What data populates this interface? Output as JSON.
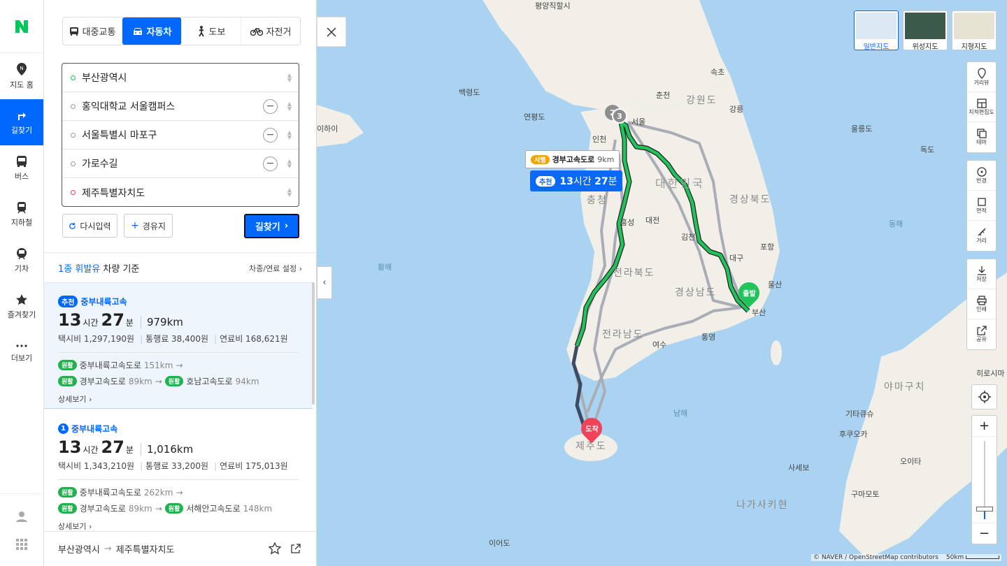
{
  "nav": {
    "items": [
      {
        "label": "지도 홈"
      },
      {
        "label": "길찾기"
      },
      {
        "label": "버스"
      },
      {
        "label": "지하철"
      },
      {
        "label": "기차"
      },
      {
        "label": "즐겨찾기"
      },
      {
        "label": "더보기"
      }
    ]
  },
  "modes": {
    "transit": "대중교통",
    "car": "자동차",
    "walk": "도보",
    "bike": "자전거"
  },
  "stops": [
    {
      "value": "부산광역시"
    },
    {
      "value": "홍익대학교 서울캠퍼스"
    },
    {
      "value": "서울특별시 마포구"
    },
    {
      "value": "가로수길"
    },
    {
      "value": "제주특별자치도"
    }
  ],
  "actions": {
    "reset": "다시입력",
    "waypoint": "경유지",
    "search": "길찾기"
  },
  "vehicle": {
    "fuel": "1종 휘발유",
    "basis": "차량 기준",
    "settings": "차종/연료 설정"
  },
  "routes": [
    {
      "tag": "추천",
      "name": "중부내륙고속",
      "hours": "13",
      "h_unit": "시간",
      "minutes": "27",
      "m_unit": "분",
      "distance": "979km",
      "taxi": "택시비 1,297,190원",
      "toll": "통행료 38,400원",
      "fuel": "연료비 168,621원",
      "road1": "중부내륙고속도로",
      "road1_km": "151km",
      "road2": "경부고속도로",
      "road2_km": "89km",
      "road3": "호남고속도로",
      "road3_km": "94km",
      "badge": "원활",
      "detail": "상세보기"
    },
    {
      "tag": "1",
      "name": "중부내륙고속",
      "hours": "13",
      "h_unit": "시간",
      "minutes": "27",
      "m_unit": "분",
      "distance": "1,016km",
      "taxi": "택시비 1,343,210원",
      "toll": "통행료 33,200원",
      "fuel": "연료비 175,013원",
      "road1": "중부내륙고속도로",
      "road1_km": "262km",
      "road2": "경부고속도로",
      "road2_km": "89km",
      "road3": "서해안고속도로",
      "road3_km": "148km",
      "badge": "원활",
      "detail": "상세보기"
    }
  ],
  "footer": {
    "from": "부산광역시",
    "to": "제주특별자치도"
  },
  "map": {
    "types": [
      {
        "label": "일반지도"
      },
      {
        "label": "위성지도"
      },
      {
        "label": "지형지도"
      }
    ],
    "tools": [
      "거리뷰",
      "지적편집도",
      "테마",
      "반경",
      "면적",
      "거리",
      "저장",
      "인쇄",
      "공유"
    ],
    "labels": {
      "pyongyang": "평양직할시",
      "sokcho": "속초",
      "chuncheon": "춘천",
      "gangwon": "강원도",
      "gangneung": "강릉",
      "baengnyeong": "백령도",
      "yeonpyeong": "연평도",
      "weihai": "이하이",
      "ulleung": "울릉도",
      "dok": "독도",
      "incheon": "인천",
      "seoul": "서울",
      "korea": "대한민국",
      "gyeongbuk": "경상북도",
      "chungnam": "충청",
      "hongseong": "홍성",
      "daejeon": "대전",
      "gimcheon": "김천",
      "pohang": "포항",
      "daegu": "대구",
      "jeonbuk": "전라북도",
      "ulsan": "울산",
      "gyeongnam": "경상남도",
      "busan": "부산",
      "jeonnam": "전라남도",
      "yeosu": "여수",
      "tongyeong": "통영",
      "jeju": "제주도",
      "south": "남해",
      "yellow": "황해",
      "east": "동해",
      "iodo": "이어도",
      "kitakyushu": "기타큐슈",
      "fukuoka": "후쿠오카",
      "oita": "오이타",
      "sasebo": "사세보",
      "kumamoto": "구마모토",
      "nagasaki": "나가사키현",
      "yamaguchi": "야마구치",
      "hiroshima": "히로시마",
      "shima": "시마"
    },
    "chip": {
      "badge": "서행",
      "road": "경부고속도로",
      "km": "9km"
    },
    "bubble": {
      "tag": "추천",
      "hours": "13",
      "h_unit": "시간",
      "minutes": "27",
      "m_unit": "분"
    },
    "start": "출발",
    "end": "도착",
    "cluster_a": "2",
    "cluster_b": "3",
    "copyright": "© NAVER / OpenStreetMap contributors",
    "scale": "50km"
  }
}
